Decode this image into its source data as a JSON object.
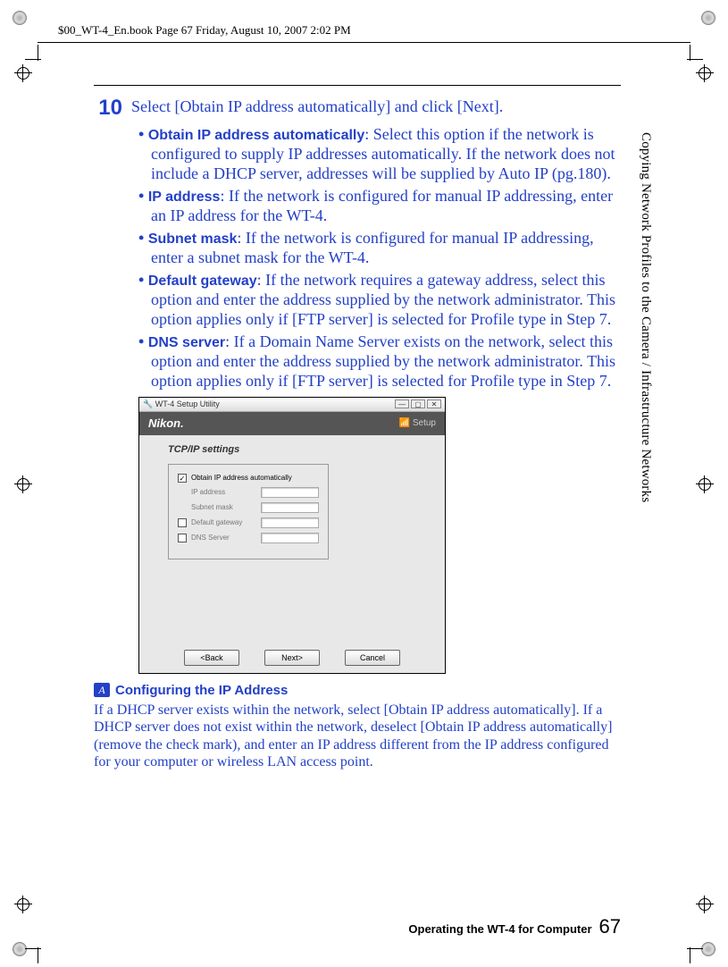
{
  "header_text": "$00_WT-4_En.book  Page 67  Friday, August 10, 2007  2:02 PM",
  "sidebar": "Copying Network Profiles to the Camera / Infrastructure Networks",
  "step": {
    "number": "10",
    "text": "Select [Obtain IP address automatically] and click [Next]."
  },
  "bullets": [
    {
      "term": "Obtain IP address automatically",
      "desc": ": Select this option if the network is configured to supply IP addresses automatically. If the network does not include a DHCP server, addresses will be supplied by Auto IP (pg.180)."
    },
    {
      "term": "IP address",
      "desc": ": If the network is configured for manual IP addressing, enter an IP address for the WT-4."
    },
    {
      "term": "Subnet mask",
      "desc": ": If the network is configured for manual IP addressing, enter a subnet mask for the WT-4."
    },
    {
      "term": "Default gateway",
      "desc": ": If the network requires a gateway address, select this option and enter the address supplied by the network administrator. This option applies only if [FTP server] is selected for Profile type in Step 7."
    },
    {
      "term": "DNS server",
      "desc": ": If a Domain Name Server exists on the network, select this option and enter the address supplied by the network administrator. This option applies only if [FTP server] is selected for Profile type in Step 7."
    }
  ],
  "dialog": {
    "title": "WT-4 Setup Utility",
    "brand": "Nikon.",
    "setup_label": "Setup",
    "panel_title": "TCP/IP settings",
    "fields": {
      "obtain_label": "Obtain IP address automatically",
      "obtain_checked": "✓",
      "ip_label": "IP address",
      "subnet_label": "Subnet mask",
      "gateway_label": "Default gateway",
      "dns_label": "DNS Server"
    },
    "buttons": {
      "back": "<Back",
      "next": "Next>",
      "cancel": "Cancel"
    }
  },
  "note": {
    "icon": "A",
    "title": "Configuring the IP Address",
    "body": "If a DHCP server exists within the network, select [Obtain IP address automatically]. If a DHCP server does not exist within the network, deselect [Obtain IP address automatically] (remove the check mark), and enter an IP address different from the IP address configured for your computer or wireless LAN access point."
  },
  "footer": {
    "label": "Operating the WT-4 for Computer",
    "page": "67"
  }
}
